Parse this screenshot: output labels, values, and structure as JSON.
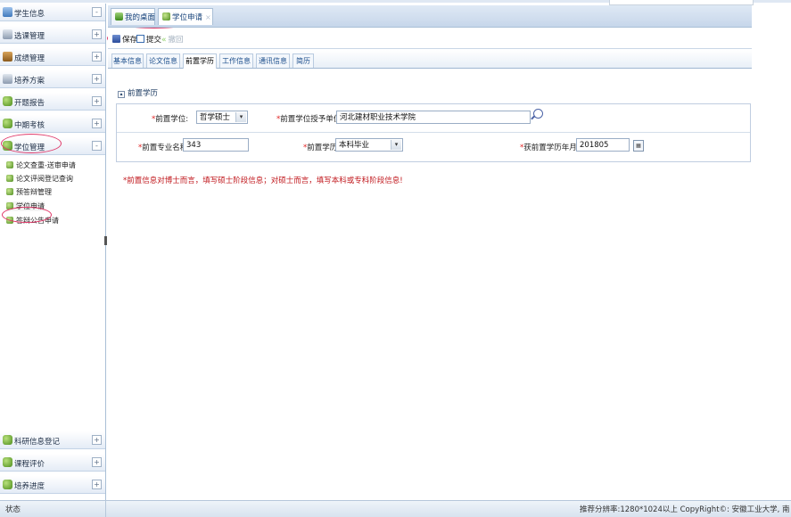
{
  "sidebar": {
    "items": [
      {
        "label": "学生信息",
        "toggle": "-"
      },
      {
        "label": "选课管理",
        "toggle": "+"
      },
      {
        "label": "成绩管理",
        "toggle": "+"
      },
      {
        "label": "培养方案",
        "toggle": "+"
      },
      {
        "label": "开题报告",
        "toggle": "+"
      },
      {
        "label": "中期考核",
        "toggle": "+"
      },
      {
        "label": "学位管理",
        "toggle": "-"
      }
    ],
    "subitems": [
      {
        "label": "论文查重-送审申请"
      },
      {
        "label": "论文评阅登记查询"
      },
      {
        "label": "预答辩管理"
      },
      {
        "label": "学位申请"
      },
      {
        "label": "答辩公告申请"
      }
    ],
    "bottom_items": [
      {
        "label": "科研信息登记",
        "toggle": "+"
      },
      {
        "label": "课程评价",
        "toggle": "+"
      },
      {
        "label": "培养进度",
        "toggle": "+"
      }
    ]
  },
  "page_tabs": [
    {
      "label": "我的桌面"
    },
    {
      "label": "学位申请",
      "close": "×"
    }
  ],
  "toolbar": {
    "save_label": "保存",
    "submit_label": "提交",
    "withdraw_label": "撤回"
  },
  "form_tabs": [
    "基本信息",
    "论文信息",
    "前置学历",
    "工作信息",
    "通讯信息",
    "简历"
  ],
  "active_form_tab": "前置学历",
  "section_title": "前置学历",
  "form": {
    "degree_label": "前置学位:",
    "degree_value": "哲学硕士",
    "granting_unit_label": "前置学位授予单位:",
    "granting_unit_value": "河北建材职业技术学院",
    "major_label": "前置专业名称:",
    "major_value": "343",
    "education_label": "前置学历:",
    "education_value": "本科毕业",
    "date_label": "获前置学历年月:",
    "date_value": "201805",
    "required_mark": "*"
  },
  "note": "*前置信息对博士而言，填写硕士阶段信息；对硕士而言，填写本科或专科阶段信息!",
  "status": {
    "left": "状态",
    "right": "推荐分辨率:1280*1024以上   CopyRight©: 安徽工业大学, 南"
  },
  "colors": {
    "highlight_circle": "#e03a6a",
    "note_text": "#c0161b",
    "required": "#e02020"
  }
}
